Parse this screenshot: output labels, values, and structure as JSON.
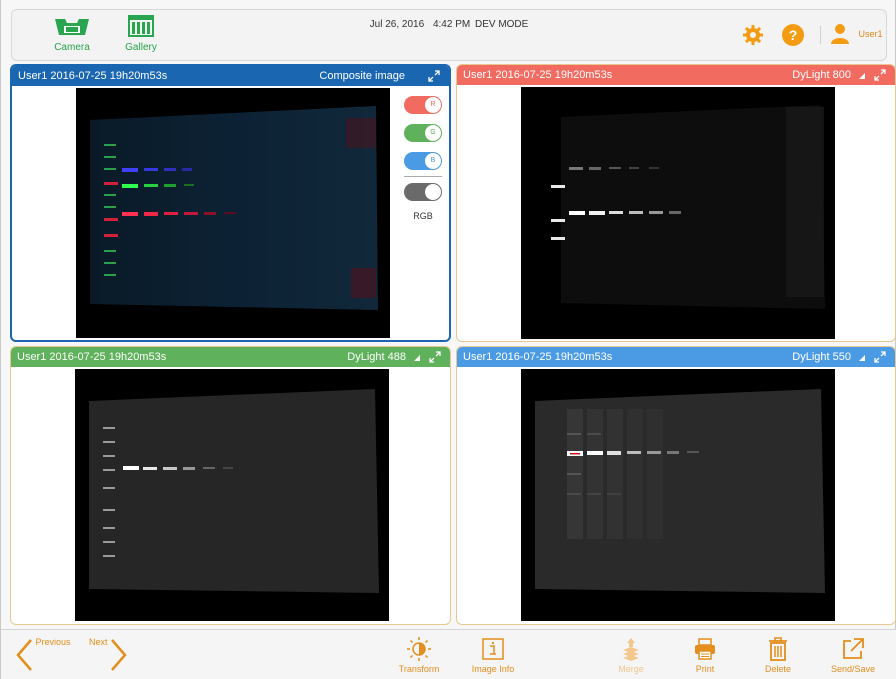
{
  "header": {
    "camera_label": "Camera",
    "gallery_label": "Gallery",
    "date": "Jul 26, 2016",
    "time": "4:42 PM",
    "mode": "DEV MODE",
    "user": "User1"
  },
  "panels": {
    "composite": {
      "title": "User1 2016-07-25 19h20m53s",
      "channel": "Composite image",
      "color": "#1a66b0",
      "toggles": {
        "r": "R",
        "g": "G",
        "b": "B",
        "rgb_label": "RGB"
      }
    },
    "dylight800": {
      "title": "User1 2016-07-25 19h20m53s",
      "channel": "DyLight 800",
      "color": "#f26b61"
    },
    "dylight488": {
      "title": "User1 2016-07-25 19h20m53s",
      "channel": "DyLight 488",
      "color": "#5fb15b"
    },
    "dylight550": {
      "title": "User1 2016-07-25 19h20m53s",
      "channel": "DyLight 550",
      "color": "#4b9be4"
    }
  },
  "footer": {
    "previous": "Previous",
    "next": "Next",
    "transform": "Transform",
    "image_info": "Image Info",
    "merge": "Merge",
    "print": "Print",
    "delete": "Delete",
    "send_save": "Send/Save"
  },
  "colors": {
    "accent": "#e38e1d",
    "brand_green": "#27a349",
    "selected": "#1a66b0"
  }
}
